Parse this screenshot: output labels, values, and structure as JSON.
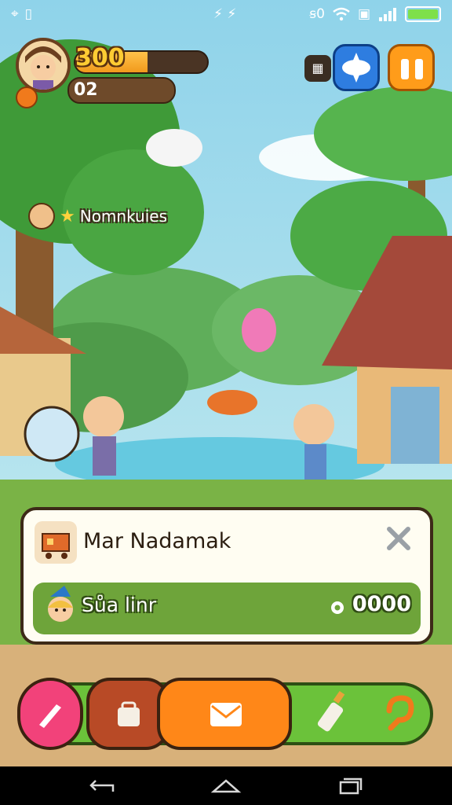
{
  "status_bar": {
    "center_icons": "⚡ ⚡",
    "right_text": "ꞩ0"
  },
  "hud": {
    "score": "300",
    "score_progress": 0.55,
    "level": "02"
  },
  "notification": {
    "text": "Nomnkuies"
  },
  "dialog": {
    "title": "Mar Nadamak",
    "row_label": "Sůa linr",
    "row_amount": "0000"
  },
  "colors": {
    "accent_orange": "#ff8718",
    "accent_green": "#6bc23a",
    "accent_pink": "#f2427a",
    "accent_blue": "#2e7de0"
  },
  "icons": [
    "pin-icon",
    "wifi-icon",
    "signal-icon",
    "battery-icon",
    "gear-icon",
    "close-icon",
    "brush-icon",
    "bag-icon",
    "mail-icon",
    "bottle-icon",
    "hook-icon",
    "back-icon",
    "home-icon",
    "recent-icon"
  ]
}
